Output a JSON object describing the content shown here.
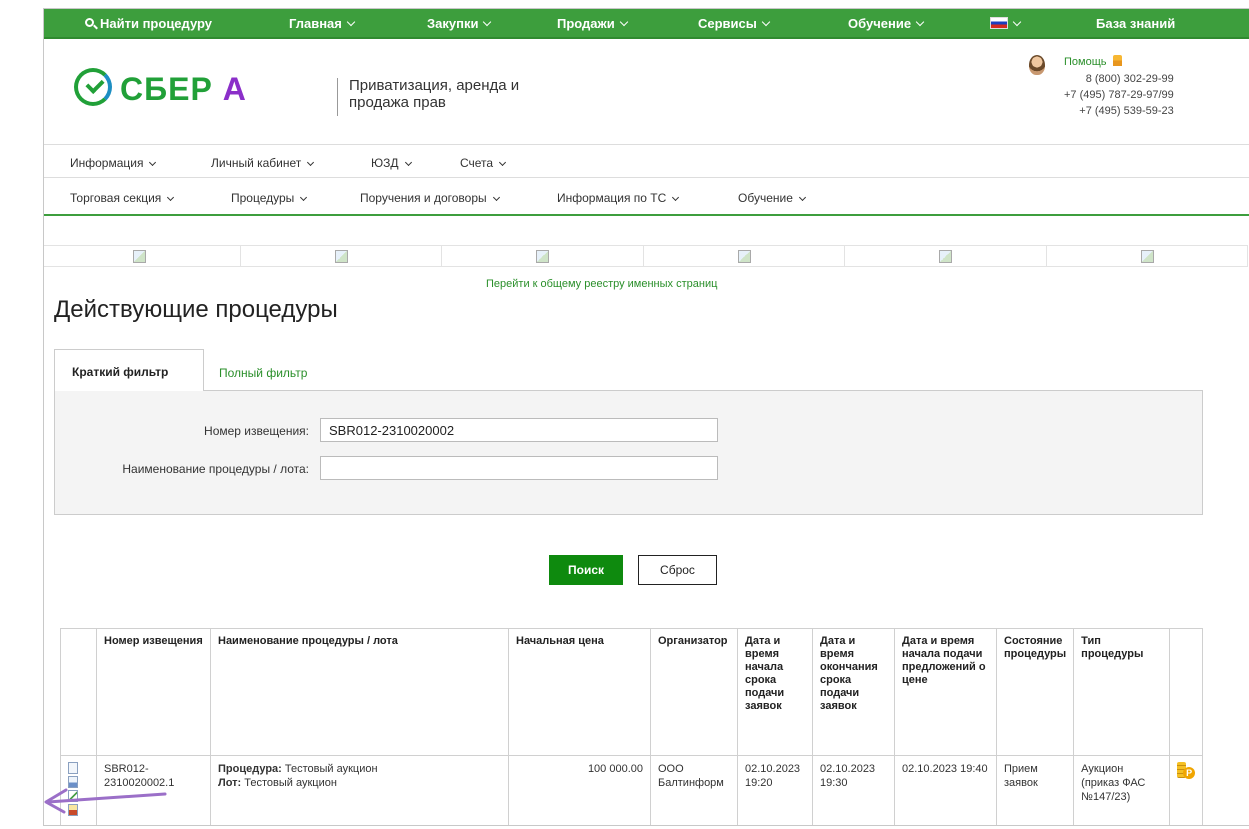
{
  "topbar": {
    "search": "Найти процедуру",
    "items": [
      "Главная",
      "Закупки",
      "Продажи",
      "Сервисы",
      "Обучение"
    ],
    "knowledge_base": "База знаний"
  },
  "header": {
    "logo_main": "СБЕР",
    "logo_letter": "А",
    "tagline": "Приватизация, аренда и продажа прав",
    "help": "Помощь",
    "phones": [
      "8 (800) 302-29-99",
      "+7 (495) 787-29-97/99",
      "+7 (495) 539-59-23"
    ]
  },
  "menu1": [
    "Информация",
    "Личный кабинет",
    "ЮЗД",
    "Счета"
  ],
  "menu2": [
    "Торговая секция",
    "Процедуры",
    "Поручения и договоры",
    "Информация по ТС",
    "Обучение"
  ],
  "registry_link": "Перейти к общему реестру именных страниц",
  "page_title": "Действующие процедуры",
  "filter": {
    "tab_short": "Краткий фильтр",
    "tab_full": "Полный фильтр",
    "notice_label": "Номер извещения:",
    "notice_value": "SBR012-2310020002",
    "name_label": "Наименование процедуры / лота:",
    "name_value": ""
  },
  "buttons": {
    "search": "Поиск",
    "reset": "Сброс"
  },
  "table": {
    "headers": {
      "notice": "Номер извещения",
      "name": "Наименование процедуры / лота",
      "price": "Начальная цена",
      "organizer": "Организатор",
      "start": "Дата и время начала срока подачи заявок",
      "end": "Дата и время окончания срока подачи заявок",
      "bids": "Дата и время начала подачи предложений о цене",
      "state": "Состояние процедуры",
      "type": "Тип процедуры"
    },
    "rows": [
      {
        "notice": "SBR012-2310020002.1",
        "proc_label": "Процедура:",
        "proc_value": "Тестовый аукцион",
        "lot_label": "Лот:",
        "lot_value": "Тестовый аукцион",
        "price": "100 000.00",
        "organizer": "ООО Балтинформ",
        "start": "02.10.2023 19:20",
        "end": "02.10.2023 19:30",
        "bids": "02.10.2023 19:40",
        "state": "Прием заявок",
        "type": "Аукцион (приказ ФАС №147/23)"
      }
    ]
  },
  "colors": {
    "brand_green": "#21a038",
    "topbar": "#3d9e3d",
    "link": "#2a8f2a",
    "button": "#0e8a0e",
    "accent_a": "#8b2fc9",
    "arrow": "#9b6fc8"
  }
}
